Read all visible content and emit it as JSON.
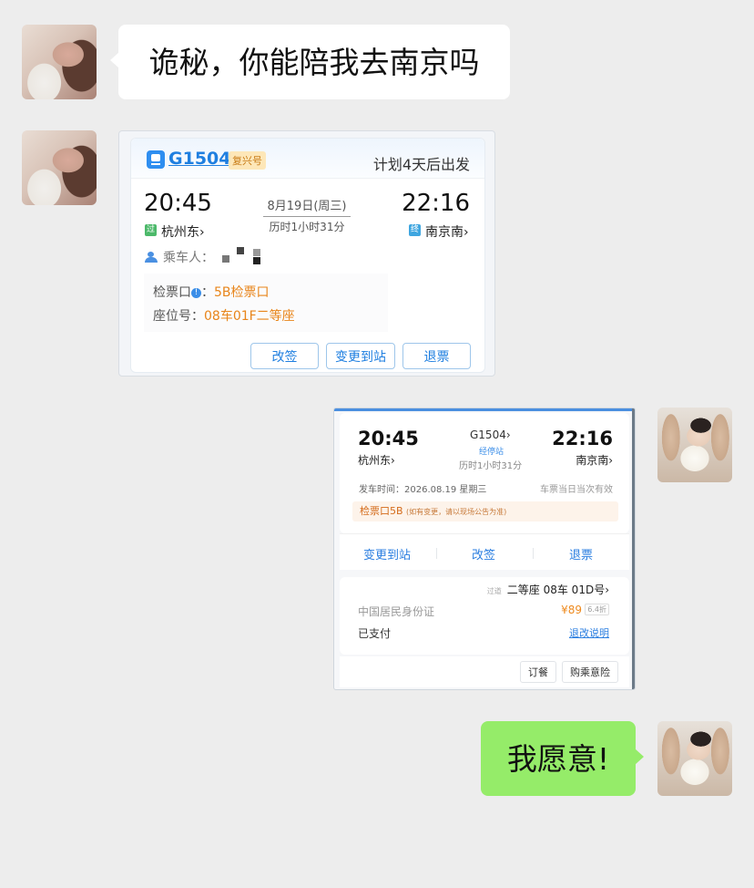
{
  "messages": {
    "msg1_text": "诡秘，你能陪我去南京吗",
    "msg4_text": "我愿意!"
  },
  "ticket1": {
    "train": "G1504",
    "badge": "复兴号",
    "plan": "计划4天后出发",
    "depart_time": "20:45",
    "arrive_time": "22:16",
    "date": "8月19日(周三)",
    "duration": "历时1小时31分",
    "from_tag": "过",
    "from": "杭州东›",
    "to_tag": "终",
    "to": "南京南›",
    "passenger_label": "乘车人：",
    "gate_label": "检票口",
    "gate_value": "5B检票口",
    "seat_label": "座位号：",
    "seat_value": "08车01F二等座",
    "btn_change": "改签",
    "btn_change_station": "变更到站",
    "btn_refund": "退票"
  },
  "ticket2": {
    "depart_time": "20:45",
    "arrive_time": "22:16",
    "train": "G1504›",
    "stop_label": "经停站",
    "duration": "历时1小时31分",
    "from": "杭州东›",
    "to": "南京南›",
    "depart_date": "发车时间：2026.08.19 星期三",
    "valid": "车票当日当次有效",
    "gate": "检票口5B",
    "gate_note": "(如有变更，请以现场公告为准)",
    "act_change_station": "变更到站",
    "act_change": "改签",
    "act_refund": "退票",
    "seat_tag": "过道",
    "seat": "二等座 08车 01D号›",
    "id_type": "中国居民身份证",
    "price": "¥89",
    "discount": "6.4折",
    "paid": "已支付",
    "rules": "退改说明",
    "btn_meal": "订餐",
    "btn_insurance": "购乘意险"
  },
  "colors": {
    "background": "#ededed",
    "bubble_right": "#95ec69",
    "bubble_left": "#ffffff",
    "accent_blue": "#1f7fe0",
    "accent_orange": "#e8851a"
  }
}
